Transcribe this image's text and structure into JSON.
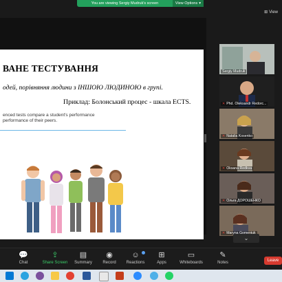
{
  "banner": {
    "message": "You are viewing Sergiy Mudruk's screen",
    "options_label": "View Options"
  },
  "view_button": "View",
  "slide": {
    "title": "ВАНЕ ТЕСТУВАННЯ",
    "line1": "одей, порівняння людини з ІНШОЮ ЛЮДИНОЮ в групі.",
    "line2": "Приклад: Болонський процес - шкала  ECTS.",
    "caption_line1": "enced tests compare a student's performance",
    "caption_line2": "performance of their peers."
  },
  "participants": [
    {
      "name": "Sergiy Mudruk",
      "muted": false
    },
    {
      "name": "Phd. Oleksandr Redorc...",
      "muted": true
    },
    {
      "name": "Natalia Kosenko",
      "muted": true
    },
    {
      "name": "Oksana Redkva",
      "muted": true
    },
    {
      "name": "Ольга ДОРОШЕНКО",
      "muted": true
    },
    {
      "name": "Maryna Gomeniuk",
      "muted": true
    }
  ],
  "toolbar": {
    "chat": "Chat",
    "share_screen": "Share Screen",
    "summary": "Summary",
    "record": "Record",
    "reactions": "Reactions",
    "apps": "Apps",
    "whiteboards": "Whiteboards",
    "notes": "Notes",
    "leave": "Leave"
  },
  "colors": {
    "banner": "#23a05c",
    "leave": "#d63a2f",
    "share_active": "#3ccf6a"
  }
}
